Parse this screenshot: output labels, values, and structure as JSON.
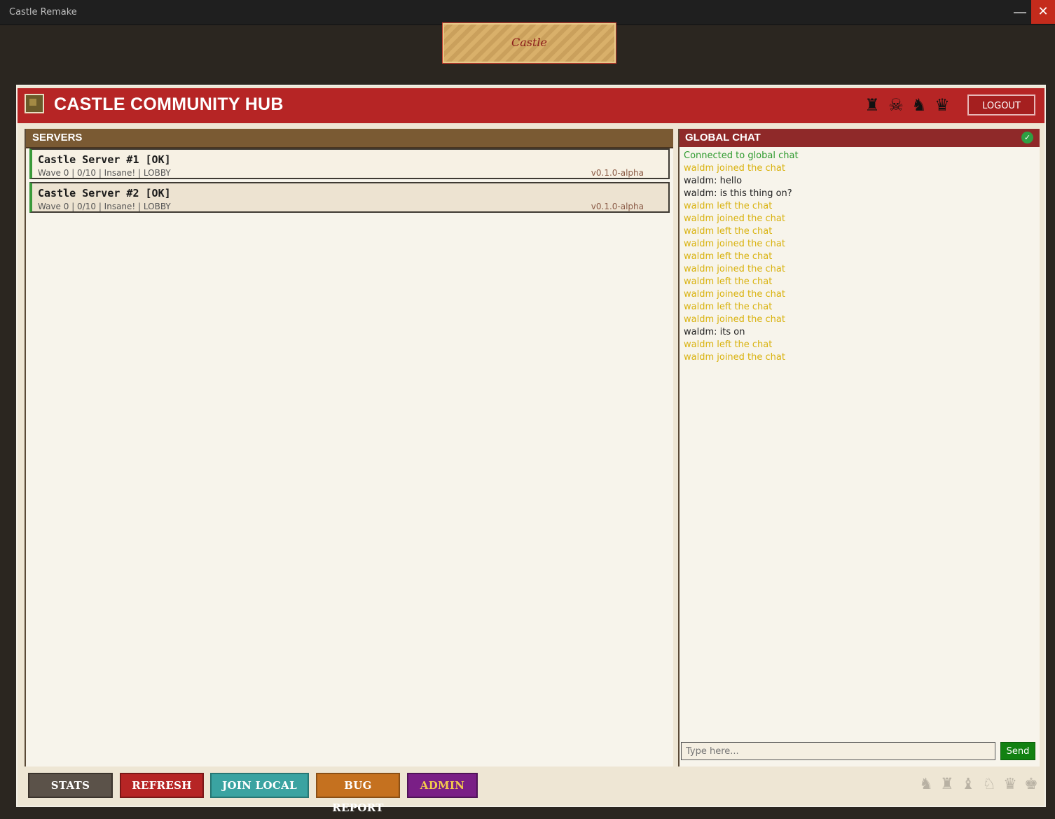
{
  "window": {
    "title": "Castle Remake",
    "minimize_glyph": "—",
    "close_glyph": "✕"
  },
  "banner": {
    "text": "Castle"
  },
  "header": {
    "title": "CASTLE COMMUNITY HUB",
    "logout_label": "LOGOUT"
  },
  "servers": {
    "title": "SERVERS",
    "items": [
      {
        "name": "Castle Server #1 [OK]",
        "meta": "Wave 0 | 0/10 | Insane! | LOBBY",
        "version": "v0.1.0-alpha"
      },
      {
        "name": "Castle Server #2 [OK]",
        "meta": "Wave 0 | 0/10 | Insane! | LOBBY",
        "version": "v0.1.0-alpha"
      }
    ]
  },
  "chat": {
    "title": "GLOBAL CHAT",
    "status_glyph": "✓",
    "messages": [
      {
        "text": "Connected to global chat",
        "kind": "system"
      },
      {
        "text": "waldm joined the chat",
        "kind": "event"
      },
      {
        "text": "waldm: hello",
        "kind": "message"
      },
      {
        "text": "waldm: is this thing on?",
        "kind": "message"
      },
      {
        "text": "waldm left the chat",
        "kind": "event"
      },
      {
        "text": "waldm joined the chat",
        "kind": "event"
      },
      {
        "text": "waldm left the chat",
        "kind": "event"
      },
      {
        "text": "waldm joined the chat",
        "kind": "event"
      },
      {
        "text": "waldm left the chat",
        "kind": "event"
      },
      {
        "text": "waldm joined the chat",
        "kind": "event"
      },
      {
        "text": "waldm left the chat",
        "kind": "event"
      },
      {
        "text": "waldm joined the chat",
        "kind": "event"
      },
      {
        "text": "waldm left the chat",
        "kind": "event"
      },
      {
        "text": "waldm joined the chat",
        "kind": "event"
      },
      {
        "text": "waldm: its on",
        "kind": "message"
      },
      {
        "text": "waldm left the chat",
        "kind": "event"
      },
      {
        "text": "waldm joined the chat",
        "kind": "event"
      }
    ],
    "input_placeholder": "Type here...",
    "send_label": "Send"
  },
  "toolbar": {
    "stats_label": "STATS",
    "refresh_label": "REFRESH",
    "join_local_label": "JOIN LOCAL",
    "bug_report_label": "BUG REPORT",
    "admin_label": "ADMIN"
  },
  "icons": {
    "header_sprites": [
      "monster-sprite-icon",
      "skeleton-sprite-icon",
      "knight-sprite-icon",
      "demon-sprite-icon"
    ],
    "footer_sprites": [
      "ghost-sprite-icon",
      "ghost-sprite-icon",
      "ghost-sprite-icon",
      "ghost-sprite-icon",
      "ghost-sprite-icon",
      "ghost-sprite-icon"
    ]
  },
  "colors": {
    "header_red": "#b62525",
    "servers_header": "#7a5a33",
    "chat_header": "#8f2929",
    "online_green": "#3a9a3a",
    "system_text": "#2e9a2e",
    "event_text": "#d9b20e",
    "send_green": "#128112"
  }
}
